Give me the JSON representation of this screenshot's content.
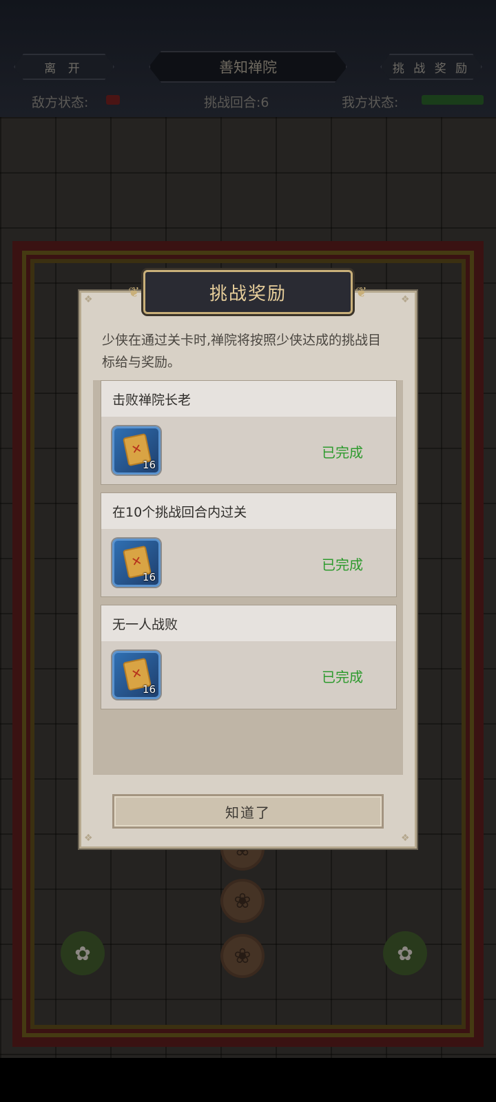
{
  "hud": {
    "leave": "离 开",
    "location": "善知禅院",
    "rewards": "挑 战 奖 励",
    "enemy_status_label": "敌方状态:",
    "round_label": "挑战回合:6",
    "our_status_label": "我方状态:"
  },
  "dialog": {
    "title": "挑战奖励",
    "description": "少侠在通过关卡时,禅院将按照少侠达成的挑战目标给与奖励。",
    "goals": [
      {
        "name": "击败禅院长老",
        "item_qty": "16",
        "status": "已完成"
      },
      {
        "name": "在10个挑战回合内过关",
        "item_qty": "16",
        "status": "已完成"
      },
      {
        "name": "无一人战败",
        "item_qty": "16",
        "status": "已完成"
      }
    ],
    "confirm": "知道了"
  },
  "colors": {
    "done": "#2d9a2d",
    "title_text": "#e8cf9b",
    "item_frame": "#5a93cf"
  },
  "icons": {
    "reward_item": "sealed-letter-icon",
    "lotus": "lotus-icon",
    "flower": "flower-icon"
  }
}
